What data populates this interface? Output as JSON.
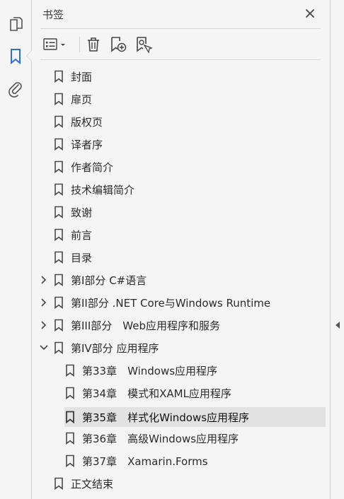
{
  "left_rail": {
    "items": [
      {
        "icon": "pages-icon"
      },
      {
        "icon": "bookmark-icon",
        "active": true
      },
      {
        "icon": "attachment-icon"
      }
    ],
    "accent": "#2a6fdb"
  },
  "panel": {
    "title": "书签",
    "close_icon": "close-icon"
  },
  "toolbar": {
    "buttons": [
      {
        "icon": "options-menu-icon"
      },
      {
        "icon": "delete-icon"
      },
      {
        "icon": "new-bookmark-icon"
      },
      {
        "icon": "bookmark-search-icon"
      }
    ]
  },
  "bookmarks": [
    {
      "label": "封面",
      "level": 0,
      "expandable": false
    },
    {
      "label": "扉页",
      "level": 0,
      "expandable": false
    },
    {
      "label": "版权页",
      "level": 0,
      "expandable": false
    },
    {
      "label": "译者序",
      "level": 0,
      "expandable": false
    },
    {
      "label": "作者简介",
      "level": 0,
      "expandable": false
    },
    {
      "label": "技术编辑简介",
      "level": 0,
      "expandable": false
    },
    {
      "label": "致谢",
      "level": 0,
      "expandable": false
    },
    {
      "label": "前言",
      "level": 0,
      "expandable": false
    },
    {
      "label": "目录",
      "level": 0,
      "expandable": false
    },
    {
      "label": "第I部分 C#语言",
      "level": 0,
      "expandable": true,
      "expanded": false
    },
    {
      "label": "第II部分 .NET Core与Windows Runtime",
      "level": 0,
      "expandable": true,
      "expanded": false
    },
    {
      "label": "第III部分　Web应用程序和服务",
      "level": 0,
      "expandable": true,
      "expanded": false
    },
    {
      "label": "第IV部分 应用程序",
      "level": 0,
      "expandable": true,
      "expanded": true
    },
    {
      "label": "第33章　Windows应用程序",
      "level": 1,
      "expandable": false
    },
    {
      "label": "第34章　模式和XAML应用程序",
      "level": 1,
      "expandable": false
    },
    {
      "label": "第35章　样式化Windows应用程序",
      "level": 1,
      "expandable": false,
      "selected": true
    },
    {
      "label": "第36章　高级Windows应用程序",
      "level": 1,
      "expandable": false
    },
    {
      "label": "第37章　Xamarin.Forms",
      "level": 1,
      "expandable": false
    },
    {
      "label": "正文结束",
      "level": 0,
      "expandable": false
    }
  ],
  "right_strip": {
    "icon": "collapse-panel-arrow-icon"
  }
}
